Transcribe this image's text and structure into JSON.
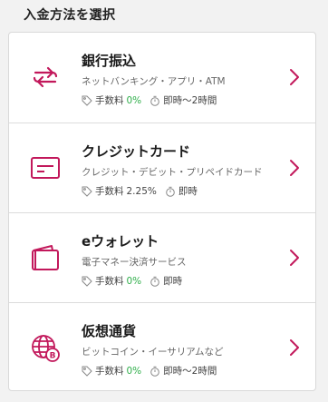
{
  "page": {
    "title": "入金方法を選択"
  },
  "accent_color": "#c2185b",
  "fee_free_color": "#2fae4a",
  "methods": [
    {
      "name": "銀行振込",
      "icon": "bank-transfer-arrows-icon",
      "description": "ネットバンキング・アプリ・ATM",
      "fee_label": "手数料",
      "fee": "0%",
      "time": "即時〜2時間"
    },
    {
      "name": "クレジットカード",
      "icon": "credit-card-icon",
      "description": "クレジット・デビット・プリペイドカード",
      "fee_label": "手数料",
      "fee": "2.25%",
      "time": "即時"
    },
    {
      "name": "eウォレット",
      "icon": "wallet-icon",
      "description": "電子マネー決済サービス",
      "fee_label": "手数料",
      "fee": "0%",
      "time": "即時"
    },
    {
      "name": "仮想通貨",
      "icon": "crypto-globe-icon",
      "description": "ビットコイン・イーサリアムなど",
      "fee_label": "手数料",
      "fee": "0%",
      "time": "即時〜2時間"
    }
  ]
}
